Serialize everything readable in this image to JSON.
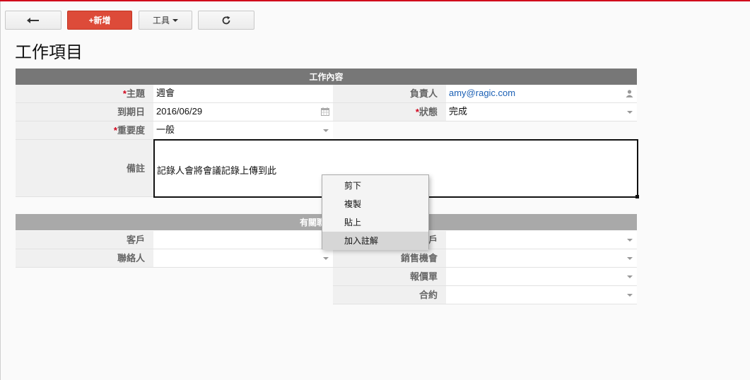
{
  "toolbar": {
    "back_icon": "arrow-left-icon",
    "new_label": "+新增",
    "tools_label": "工具",
    "refresh_icon": "refresh-icon"
  },
  "page": {
    "title": "工作項目"
  },
  "section1": {
    "header": "工作內容",
    "fields": {
      "subject": {
        "required_mark": "*",
        "label": "主題",
        "value": "週會"
      },
      "assignee": {
        "label": "負責人",
        "value": "amy@ragic.com"
      },
      "due_date": {
        "label": "到期日",
        "value": "2016/06/29"
      },
      "status": {
        "required_mark": "*",
        "label": "狀態",
        "value": "完成"
      },
      "priority": {
        "required_mark": "*",
        "label": "重要度",
        "value": "一般"
      },
      "notes": {
        "label": "備註",
        "value": "記錄人會將會議記錄上傳到此"
      }
    }
  },
  "section2": {
    "header_visible": "有關聯",
    "fields": {
      "customer": {
        "label": "客戶"
      },
      "account_partial": {
        "label": "戶"
      },
      "contact": {
        "label": "聯絡人"
      },
      "opportunity": {
        "label": "銷售機會"
      },
      "quote": {
        "label": "報價單"
      },
      "contract": {
        "label": "合約"
      }
    }
  },
  "context_menu": {
    "items": [
      {
        "label": "剪下"
      },
      {
        "label": "複製"
      },
      {
        "label": "貼上"
      },
      {
        "label": "加入註解",
        "highlighted": true
      }
    ]
  },
  "colors": {
    "accent_red": "#dd4b39",
    "section_header": "#777777",
    "link_blue": "#1a5fb4"
  }
}
